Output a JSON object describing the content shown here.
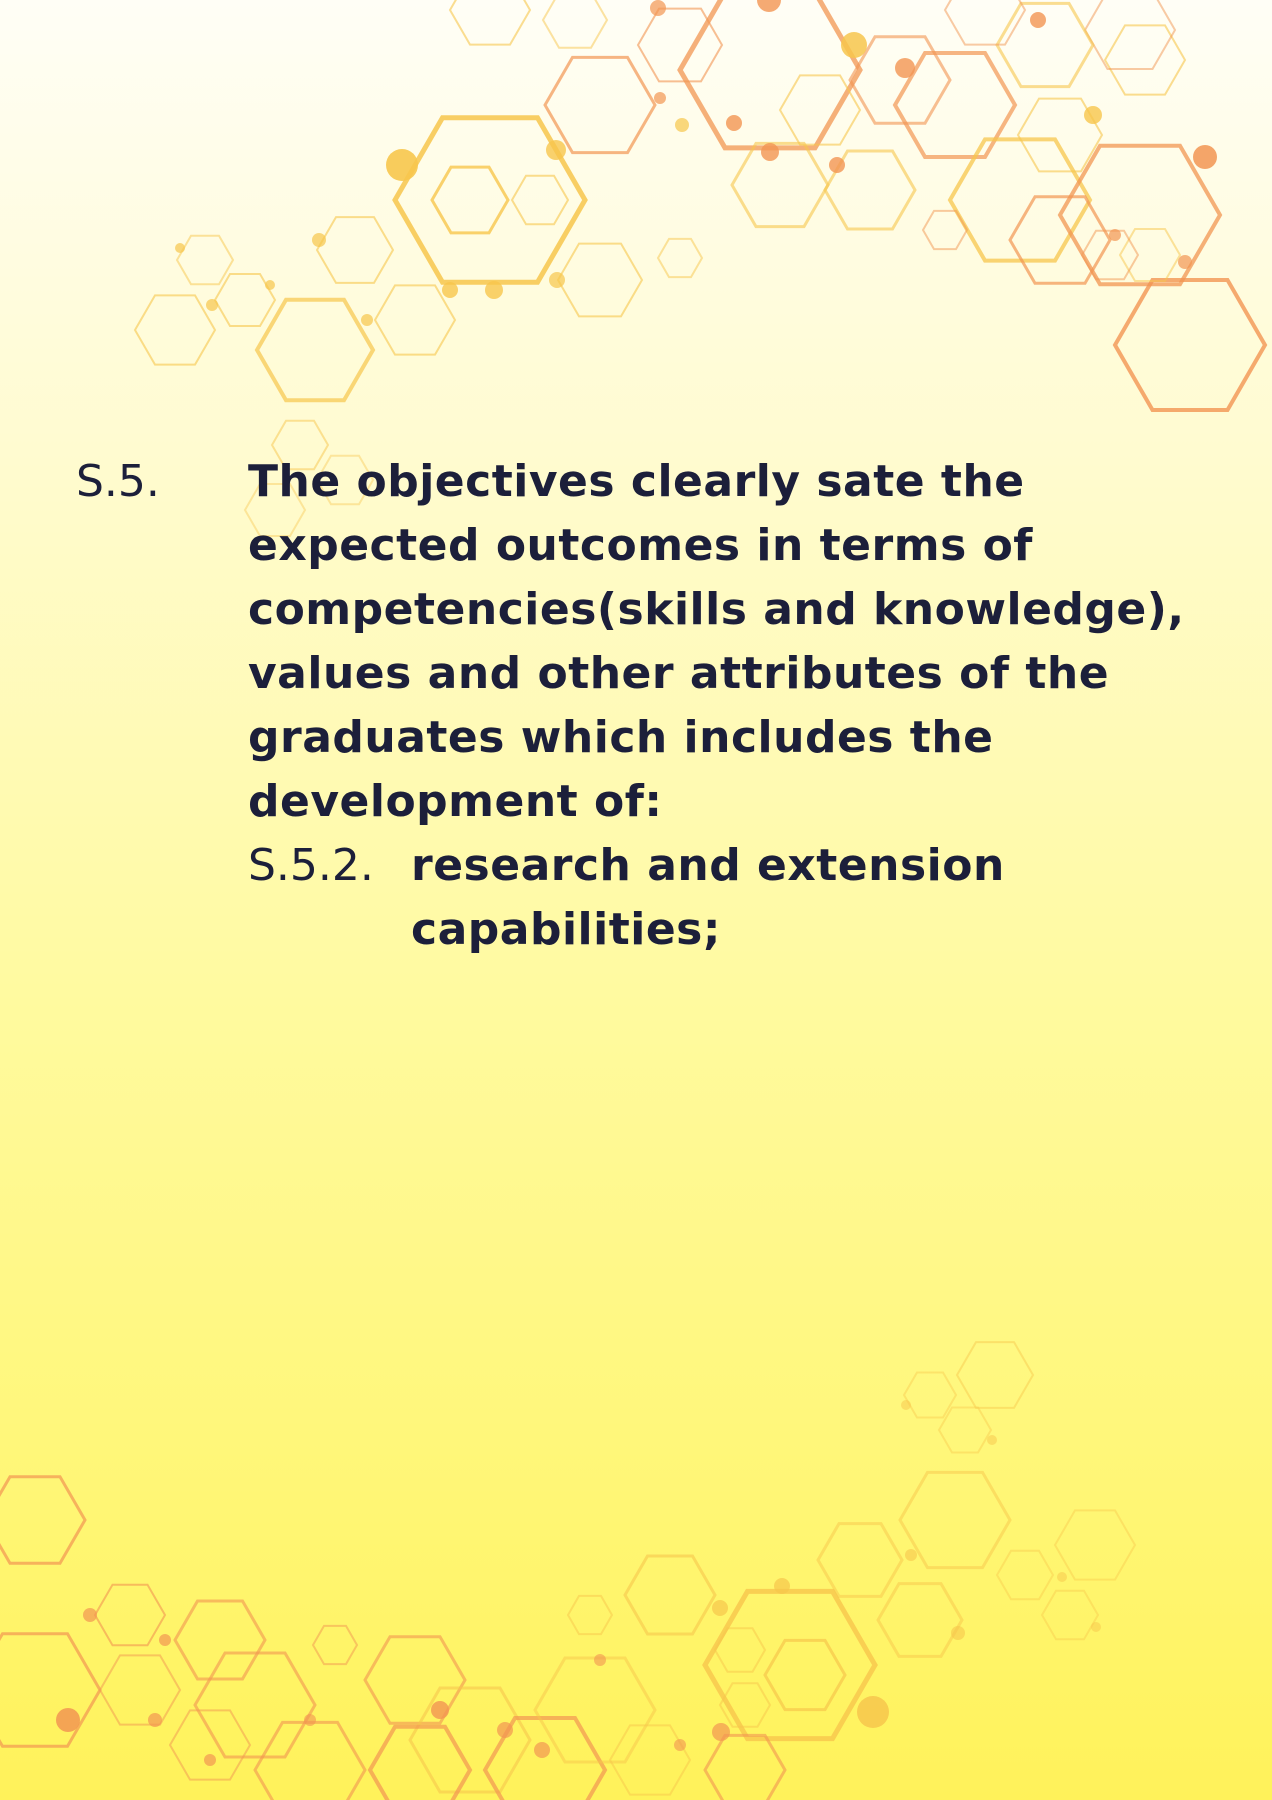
{
  "document": {
    "item": {
      "label": "S.5.",
      "lines": [
        "The objectives clearly sate the",
        "expected outcomes in terms of",
        "competencies(skills and knowledge),",
        "values and other attributes of the",
        "graduates which includes the",
        "development of:"
      ]
    },
    "subitem": {
      "label": "S.5.2.",
      "lines": [
        "research and extension",
        "capabilities;"
      ]
    }
  },
  "decoration": {
    "icon": "hexagon-network-pattern",
    "colors": {
      "gold": "#f7c64c",
      "orange": "#f29552",
      "amber": "#f6b155"
    }
  }
}
